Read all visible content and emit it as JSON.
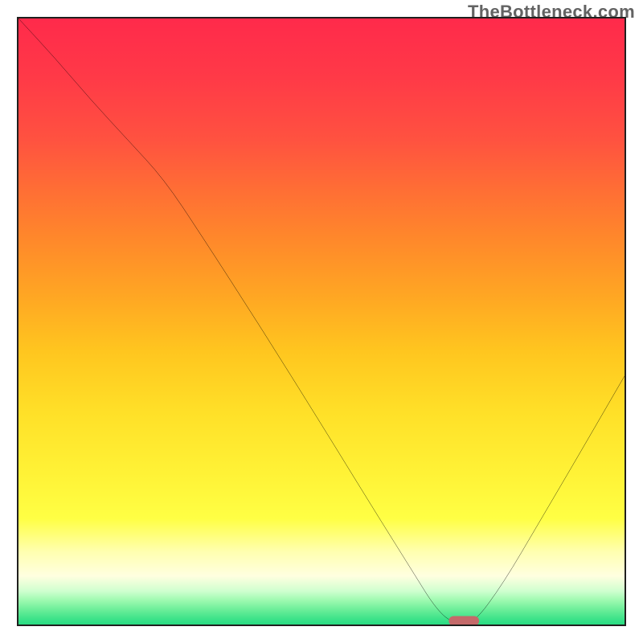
{
  "watermark": "TheBottleneck.com",
  "chart_data": {
    "type": "line",
    "title": "",
    "xlabel": "",
    "ylabel": "",
    "xlim": [
      0,
      100
    ],
    "ylim": [
      0,
      100
    ],
    "description": "Bottleneck curve over a rainbow gradient (red top → green bottom). The curve starts at the top-left, descends with a knee near x≈24, reaches a minimum at the bottom near x≈73, then rises toward the top-right. A small rounded maroon marker sits at the minimum.",
    "series": [
      {
        "name": "bottleneck-curve",
        "x": [
          0,
          6,
          12,
          18,
          24,
          30,
          40,
          50,
          58,
          65,
          69,
          72,
          75,
          80,
          86,
          92,
          100
        ],
        "values": [
          100,
          93.5,
          86.5,
          80.0,
          73.5,
          64.5,
          49.0,
          33.0,
          20.0,
          8.8,
          2.4,
          0.0,
          0.0,
          6.8,
          17.0,
          27.2,
          41.0
        ]
      }
    ],
    "marker": {
      "x": 73.5,
      "y": 0.6,
      "width_pct": 5.0,
      "height_pct": 1.6,
      "color": "#c46a6a"
    },
    "gradient_stops": [
      {
        "pct": 0,
        "color": "#ff2a4b"
      },
      {
        "pct": 82,
        "color": "#ffff44"
      },
      {
        "pct": 100,
        "color": "#29db82"
      }
    ]
  }
}
